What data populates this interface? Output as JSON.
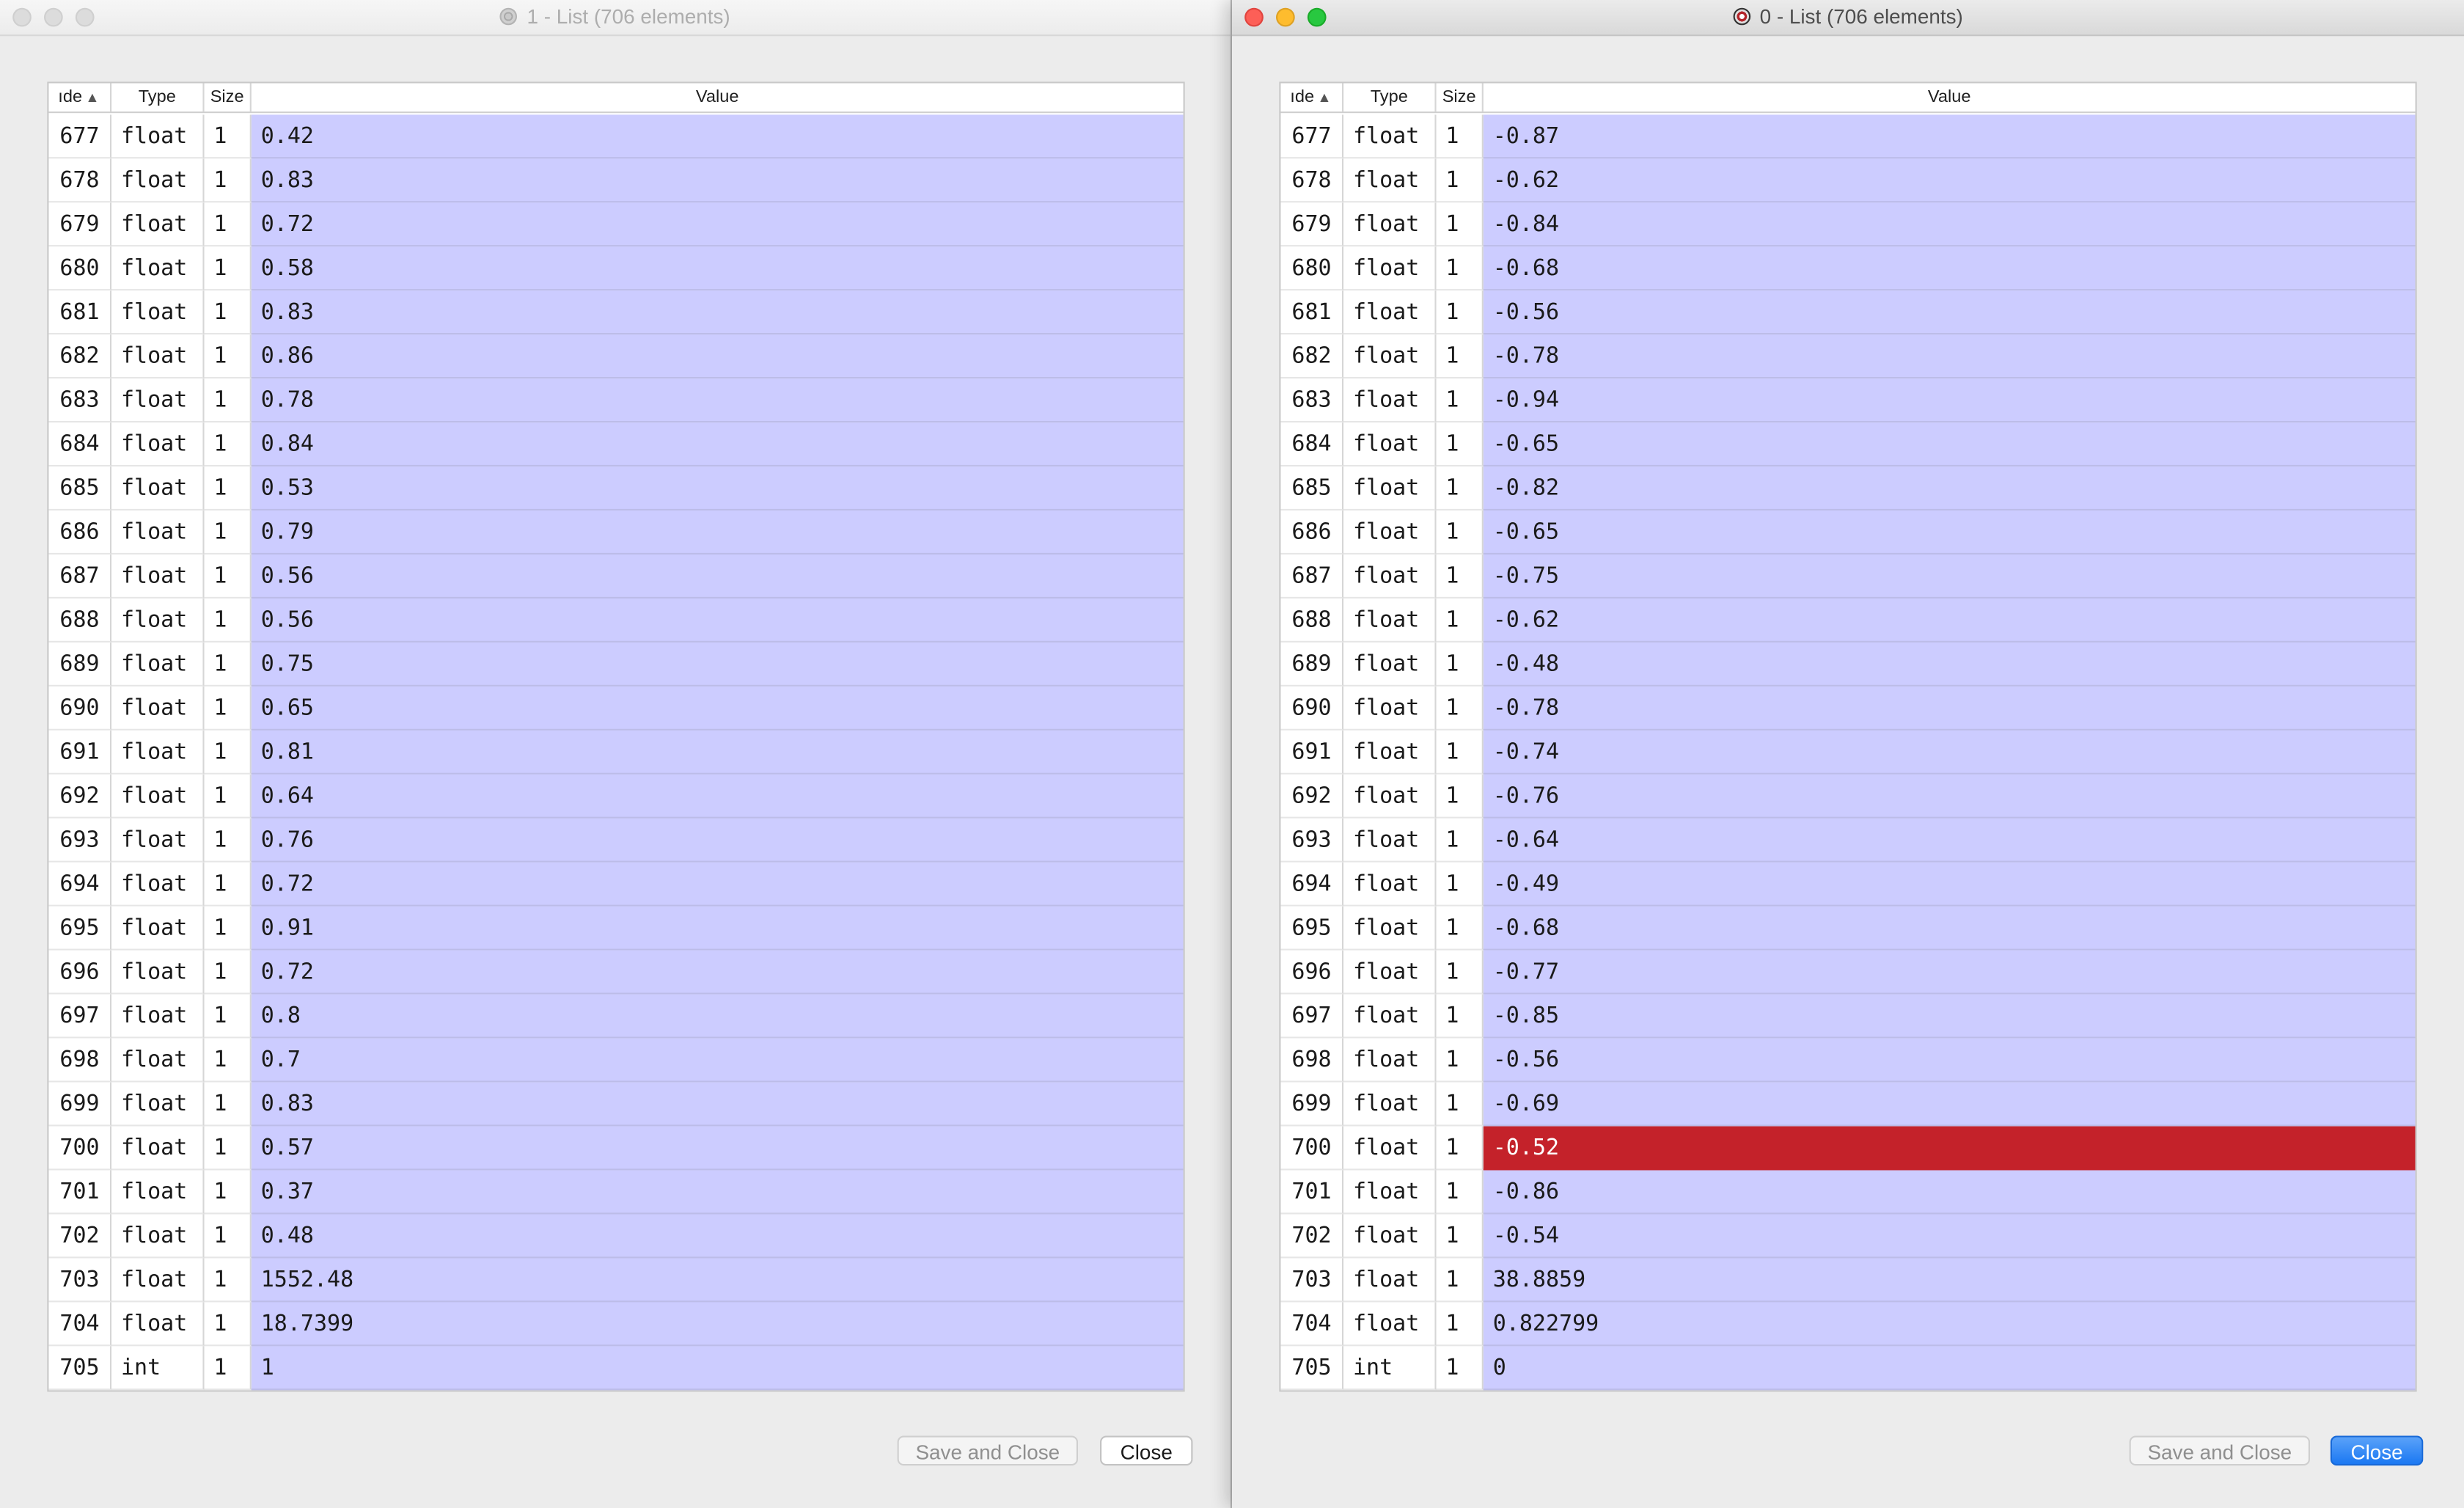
{
  "windows": [
    {
      "id": "left",
      "title": "1 - List (706 elements)",
      "active": false,
      "columns": {
        "index": "ıde",
        "type": "Type",
        "size": "Size",
        "value": "Value"
      },
      "sort_icon": "▲",
      "selected_row_index": null,
      "rows": [
        {
          "index": "677",
          "type": "float",
          "size": "1",
          "value": "0.42"
        },
        {
          "index": "678",
          "type": "float",
          "size": "1",
          "value": "0.83"
        },
        {
          "index": "679",
          "type": "float",
          "size": "1",
          "value": "0.72"
        },
        {
          "index": "680",
          "type": "float",
          "size": "1",
          "value": "0.58"
        },
        {
          "index": "681",
          "type": "float",
          "size": "1",
          "value": "0.83"
        },
        {
          "index": "682",
          "type": "float",
          "size": "1",
          "value": "0.86"
        },
        {
          "index": "683",
          "type": "float",
          "size": "1",
          "value": "0.78"
        },
        {
          "index": "684",
          "type": "float",
          "size": "1",
          "value": "0.84"
        },
        {
          "index": "685",
          "type": "float",
          "size": "1",
          "value": "0.53"
        },
        {
          "index": "686",
          "type": "float",
          "size": "1",
          "value": "0.79"
        },
        {
          "index": "687",
          "type": "float",
          "size": "1",
          "value": "0.56"
        },
        {
          "index": "688",
          "type": "float",
          "size": "1",
          "value": "0.56"
        },
        {
          "index": "689",
          "type": "float",
          "size": "1",
          "value": "0.75"
        },
        {
          "index": "690",
          "type": "float",
          "size": "1",
          "value": "0.65"
        },
        {
          "index": "691",
          "type": "float",
          "size": "1",
          "value": "0.81"
        },
        {
          "index": "692",
          "type": "float",
          "size": "1",
          "value": "0.64"
        },
        {
          "index": "693",
          "type": "float",
          "size": "1",
          "value": "0.76"
        },
        {
          "index": "694",
          "type": "float",
          "size": "1",
          "value": "0.72"
        },
        {
          "index": "695",
          "type": "float",
          "size": "1",
          "value": "0.91"
        },
        {
          "index": "696",
          "type": "float",
          "size": "1",
          "value": "0.72"
        },
        {
          "index": "697",
          "type": "float",
          "size": "1",
          "value": "0.8"
        },
        {
          "index": "698",
          "type": "float",
          "size": "1",
          "value": "0.7"
        },
        {
          "index": "699",
          "type": "float",
          "size": "1",
          "value": "0.83"
        },
        {
          "index": "700",
          "type": "float",
          "size": "1",
          "value": "0.57"
        },
        {
          "index": "701",
          "type": "float",
          "size": "1",
          "value": "0.37"
        },
        {
          "index": "702",
          "type": "float",
          "size": "1",
          "value": "0.48"
        },
        {
          "index": "703",
          "type": "float",
          "size": "1",
          "value": "1552.48"
        },
        {
          "index": "704",
          "type": "float",
          "size": "1",
          "value": "18.7399"
        },
        {
          "index": "705",
          "type": "int",
          "size": "1",
          "value": "1"
        }
      ],
      "buttons": {
        "save": "Save and Close",
        "close": "Close"
      }
    },
    {
      "id": "right",
      "title": "0 - List (706 elements)",
      "active": true,
      "columns": {
        "index": "ıde",
        "type": "Type",
        "size": "Size",
        "value": "Value"
      },
      "sort_icon": "▲",
      "selected_row_index": 23,
      "rows": [
        {
          "index": "677",
          "type": "float",
          "size": "1",
          "value": "-0.87"
        },
        {
          "index": "678",
          "type": "float",
          "size": "1",
          "value": "-0.62"
        },
        {
          "index": "679",
          "type": "float",
          "size": "1",
          "value": "-0.84"
        },
        {
          "index": "680",
          "type": "float",
          "size": "1",
          "value": "-0.68"
        },
        {
          "index": "681",
          "type": "float",
          "size": "1",
          "value": "-0.56"
        },
        {
          "index": "682",
          "type": "float",
          "size": "1",
          "value": "-0.78"
        },
        {
          "index": "683",
          "type": "float",
          "size": "1",
          "value": "-0.94"
        },
        {
          "index": "684",
          "type": "float",
          "size": "1",
          "value": "-0.65"
        },
        {
          "index": "685",
          "type": "float",
          "size": "1",
          "value": "-0.82"
        },
        {
          "index": "686",
          "type": "float",
          "size": "1",
          "value": "-0.65"
        },
        {
          "index": "687",
          "type": "float",
          "size": "1",
          "value": "-0.75"
        },
        {
          "index": "688",
          "type": "float",
          "size": "1",
          "value": "-0.62"
        },
        {
          "index": "689",
          "type": "float",
          "size": "1",
          "value": "-0.48"
        },
        {
          "index": "690",
          "type": "float",
          "size": "1",
          "value": "-0.78"
        },
        {
          "index": "691",
          "type": "float",
          "size": "1",
          "value": "-0.74"
        },
        {
          "index": "692",
          "type": "float",
          "size": "1",
          "value": "-0.76"
        },
        {
          "index": "693",
          "type": "float",
          "size": "1",
          "value": "-0.64"
        },
        {
          "index": "694",
          "type": "float",
          "size": "1",
          "value": "-0.49"
        },
        {
          "index": "695",
          "type": "float",
          "size": "1",
          "value": "-0.68"
        },
        {
          "index": "696",
          "type": "float",
          "size": "1",
          "value": "-0.77"
        },
        {
          "index": "697",
          "type": "float",
          "size": "1",
          "value": "-0.85"
        },
        {
          "index": "698",
          "type": "float",
          "size": "1",
          "value": "-0.56"
        },
        {
          "index": "699",
          "type": "float",
          "size": "1",
          "value": "-0.69"
        },
        {
          "index": "700",
          "type": "float",
          "size": "1",
          "value": "-0.52"
        },
        {
          "index": "701",
          "type": "float",
          "size": "1",
          "value": "-0.86"
        },
        {
          "index": "702",
          "type": "float",
          "size": "1",
          "value": "-0.54"
        },
        {
          "index": "703",
          "type": "float",
          "size": "1",
          "value": "38.8859"
        },
        {
          "index": "704",
          "type": "float",
          "size": "1",
          "value": "0.822799"
        },
        {
          "index": "705",
          "type": "int",
          "size": "1",
          "value": "0"
        }
      ],
      "buttons": {
        "save": "Save and Close",
        "close": "Close"
      }
    }
  ],
  "colors": {
    "value_cell_bg": "#ccccff",
    "selected_value_bg": "#c4222a",
    "default_button_blue": "#1b78f2"
  },
  "icons": {
    "traffic_lights": [
      "close-light",
      "minimize-light",
      "zoom-light"
    ],
    "title_app_icon": "app-icon",
    "sort": "sort-ascending-icon"
  }
}
